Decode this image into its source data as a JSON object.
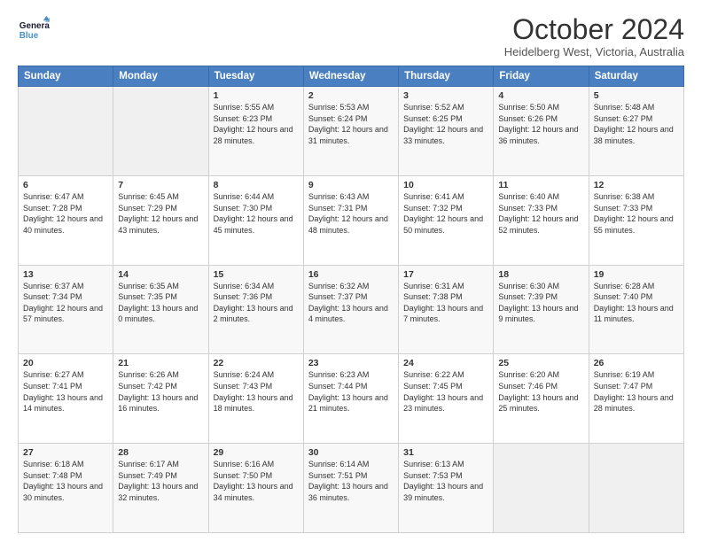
{
  "logo": {
    "text_general": "General",
    "text_blue": "Blue"
  },
  "header": {
    "month_title": "October 2024",
    "location": "Heidelberg West, Victoria, Australia"
  },
  "days_of_week": [
    "Sunday",
    "Monday",
    "Tuesday",
    "Wednesday",
    "Thursday",
    "Friday",
    "Saturday"
  ],
  "weeks": [
    [
      {
        "day": "",
        "info": ""
      },
      {
        "day": "",
        "info": ""
      },
      {
        "day": "1",
        "info": "Sunrise: 5:55 AM\nSunset: 6:23 PM\nDaylight: 12 hours and 28 minutes."
      },
      {
        "day": "2",
        "info": "Sunrise: 5:53 AM\nSunset: 6:24 PM\nDaylight: 12 hours and 31 minutes."
      },
      {
        "day": "3",
        "info": "Sunrise: 5:52 AM\nSunset: 6:25 PM\nDaylight: 12 hours and 33 minutes."
      },
      {
        "day": "4",
        "info": "Sunrise: 5:50 AM\nSunset: 6:26 PM\nDaylight: 12 hours and 36 minutes."
      },
      {
        "day": "5",
        "info": "Sunrise: 5:48 AM\nSunset: 6:27 PM\nDaylight: 12 hours and 38 minutes."
      }
    ],
    [
      {
        "day": "6",
        "info": "Sunrise: 6:47 AM\nSunset: 7:28 PM\nDaylight: 12 hours and 40 minutes."
      },
      {
        "day": "7",
        "info": "Sunrise: 6:45 AM\nSunset: 7:29 PM\nDaylight: 12 hours and 43 minutes."
      },
      {
        "day": "8",
        "info": "Sunrise: 6:44 AM\nSunset: 7:30 PM\nDaylight: 12 hours and 45 minutes."
      },
      {
        "day": "9",
        "info": "Sunrise: 6:43 AM\nSunset: 7:31 PM\nDaylight: 12 hours and 48 minutes."
      },
      {
        "day": "10",
        "info": "Sunrise: 6:41 AM\nSunset: 7:32 PM\nDaylight: 12 hours and 50 minutes."
      },
      {
        "day": "11",
        "info": "Sunrise: 6:40 AM\nSunset: 7:33 PM\nDaylight: 12 hours and 52 minutes."
      },
      {
        "day": "12",
        "info": "Sunrise: 6:38 AM\nSunset: 7:33 PM\nDaylight: 12 hours and 55 minutes."
      }
    ],
    [
      {
        "day": "13",
        "info": "Sunrise: 6:37 AM\nSunset: 7:34 PM\nDaylight: 12 hours and 57 minutes."
      },
      {
        "day": "14",
        "info": "Sunrise: 6:35 AM\nSunset: 7:35 PM\nDaylight: 13 hours and 0 minutes."
      },
      {
        "day": "15",
        "info": "Sunrise: 6:34 AM\nSunset: 7:36 PM\nDaylight: 13 hours and 2 minutes."
      },
      {
        "day": "16",
        "info": "Sunrise: 6:32 AM\nSunset: 7:37 PM\nDaylight: 13 hours and 4 minutes."
      },
      {
        "day": "17",
        "info": "Sunrise: 6:31 AM\nSunset: 7:38 PM\nDaylight: 13 hours and 7 minutes."
      },
      {
        "day": "18",
        "info": "Sunrise: 6:30 AM\nSunset: 7:39 PM\nDaylight: 13 hours and 9 minutes."
      },
      {
        "day": "19",
        "info": "Sunrise: 6:28 AM\nSunset: 7:40 PM\nDaylight: 13 hours and 11 minutes."
      }
    ],
    [
      {
        "day": "20",
        "info": "Sunrise: 6:27 AM\nSunset: 7:41 PM\nDaylight: 13 hours and 14 minutes."
      },
      {
        "day": "21",
        "info": "Sunrise: 6:26 AM\nSunset: 7:42 PM\nDaylight: 13 hours and 16 minutes."
      },
      {
        "day": "22",
        "info": "Sunrise: 6:24 AM\nSunset: 7:43 PM\nDaylight: 13 hours and 18 minutes."
      },
      {
        "day": "23",
        "info": "Sunrise: 6:23 AM\nSunset: 7:44 PM\nDaylight: 13 hours and 21 minutes."
      },
      {
        "day": "24",
        "info": "Sunrise: 6:22 AM\nSunset: 7:45 PM\nDaylight: 13 hours and 23 minutes."
      },
      {
        "day": "25",
        "info": "Sunrise: 6:20 AM\nSunset: 7:46 PM\nDaylight: 13 hours and 25 minutes."
      },
      {
        "day": "26",
        "info": "Sunrise: 6:19 AM\nSunset: 7:47 PM\nDaylight: 13 hours and 28 minutes."
      }
    ],
    [
      {
        "day": "27",
        "info": "Sunrise: 6:18 AM\nSunset: 7:48 PM\nDaylight: 13 hours and 30 minutes."
      },
      {
        "day": "28",
        "info": "Sunrise: 6:17 AM\nSunset: 7:49 PM\nDaylight: 13 hours and 32 minutes."
      },
      {
        "day": "29",
        "info": "Sunrise: 6:16 AM\nSunset: 7:50 PM\nDaylight: 13 hours and 34 minutes."
      },
      {
        "day": "30",
        "info": "Sunrise: 6:14 AM\nSunset: 7:51 PM\nDaylight: 13 hours and 36 minutes."
      },
      {
        "day": "31",
        "info": "Sunrise: 6:13 AM\nSunset: 7:53 PM\nDaylight: 13 hours and 39 minutes."
      },
      {
        "day": "",
        "info": ""
      },
      {
        "day": "",
        "info": ""
      }
    ]
  ]
}
